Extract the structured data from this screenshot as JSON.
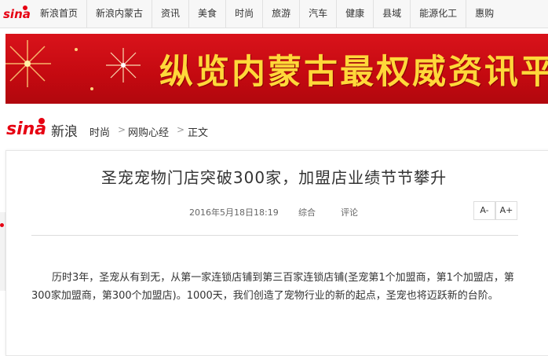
{
  "topnav": {
    "logo": "sina",
    "items": [
      "新浪首页",
      "新浪内蒙古",
      "资讯",
      "美食",
      "时尚",
      "旅游",
      "汽车",
      "健康",
      "县域",
      "能源化工",
      "惠购"
    ]
  },
  "banner": {
    "slogan": "纵览内蒙古最权威资讯平台"
  },
  "breadcrumb": {
    "brand": "新浪",
    "items": [
      "时尚",
      "网购心经",
      "正文"
    ]
  },
  "article": {
    "title": "圣宠宠物门店突破300家，加盟店业绩节节攀升",
    "date": "2016年5月18日18:19",
    "category": "综合",
    "comment": "评论",
    "font_smaller": "A-",
    "font_larger": "A+",
    "paragraph": "历时3年，圣宠从有到无，从第一家连锁店铺到第三百家连锁店铺(圣宠第1个加盟商，第1个加盟店，第300家加盟商，第300个加盟店)。1000天，我们创造了宠物行业的新的起点，圣宠也将迈跃新的台阶。"
  },
  "colors": {
    "brand_red": "#e60012",
    "banner_text": "#ffd83a",
    "banner_bg": "#c40910"
  }
}
